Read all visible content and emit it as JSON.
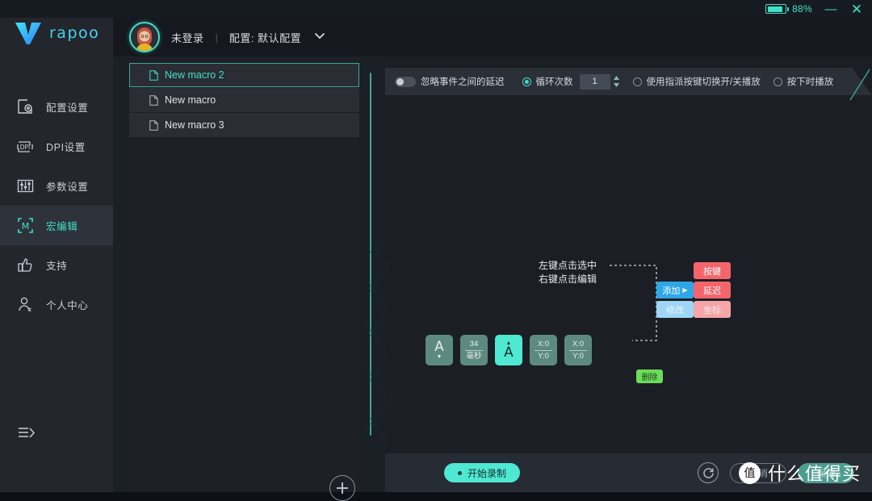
{
  "titlebar": {
    "battery_percent": "88%",
    "battery_level": 88,
    "minimize_label": "—",
    "close_label": "✕",
    "accent": "#3fe0c8"
  },
  "sidebar": {
    "brand": "rapoo",
    "items": [
      {
        "icon": "config-icon",
        "label": "配置设置",
        "active": false
      },
      {
        "icon": "dpi-icon",
        "label": "DPI设置",
        "active": false
      },
      {
        "icon": "sliders-icon",
        "label": "参数设置",
        "active": false
      },
      {
        "icon": "macro-icon",
        "label": "宏编辑",
        "active": true
      },
      {
        "icon": "thumbsup-icon",
        "label": "支持",
        "active": false
      },
      {
        "icon": "person-icon",
        "label": "个人中心",
        "active": false
      }
    ],
    "collapse_icon": "collapse-icon"
  },
  "header": {
    "login_status": "未登录",
    "separator": "|",
    "profile_label": "配置: 默认配置",
    "chevron": "⌄"
  },
  "macro_list": {
    "items": [
      {
        "name": "New macro 2",
        "selected": true
      },
      {
        "name": "New macro",
        "selected": false
      },
      {
        "name": "New macro 3",
        "selected": false
      }
    ],
    "add_button_label": "+"
  },
  "toolbar": {
    "ignore_delay_label": "忽略事件之间的延迟",
    "ignore_delay_on": false,
    "loop_count_label": "循环次数",
    "loop_count_selected": true,
    "loop_count_value": "1",
    "toggle_play_label": "使用指派按键切换开/关播放",
    "toggle_play_selected": false,
    "press_play_label": "按下时播放",
    "press_play_selected": false
  },
  "canvas": {
    "callout_line1": "左键点击选中",
    "callout_line2": "右键点击编辑",
    "context_menu": {
      "add_label": "添加",
      "add_arrow": "▶",
      "modify_label": "修改",
      "submenu": [
        {
          "label": "按键",
          "color": "#f4656b"
        },
        {
          "label": "延迟",
          "color": "#f4656b"
        },
        {
          "label": "坐标",
          "color": "#f6a5a8"
        }
      ]
    },
    "events": [
      {
        "kind": "key-up",
        "top": "▲",
        "main": "",
        "bottom": "",
        "key": "A",
        "dir": "down",
        "highlight": false
      },
      {
        "kind": "delay",
        "top": "34",
        "main": "",
        "bottom": "毫秒",
        "highlight": false
      },
      {
        "kind": "key-down",
        "top": "▲",
        "main": "A",
        "bottom": "",
        "highlight": true
      },
      {
        "kind": "coordinate",
        "top": "X:0",
        "main": "",
        "bottom": "Y:0",
        "highlight": false
      },
      {
        "kind": "coordinate",
        "top": "X:0",
        "main": "",
        "bottom": "Y:0",
        "highlight": false
      }
    ],
    "delete_label": "删除"
  },
  "bottombar": {
    "record_label": "开始录制",
    "refresh_icon": "refresh-icon",
    "cancel_label": "取消",
    "save_label": "保存"
  },
  "watermark": {
    "badge": "值",
    "text": "什么值得买"
  }
}
